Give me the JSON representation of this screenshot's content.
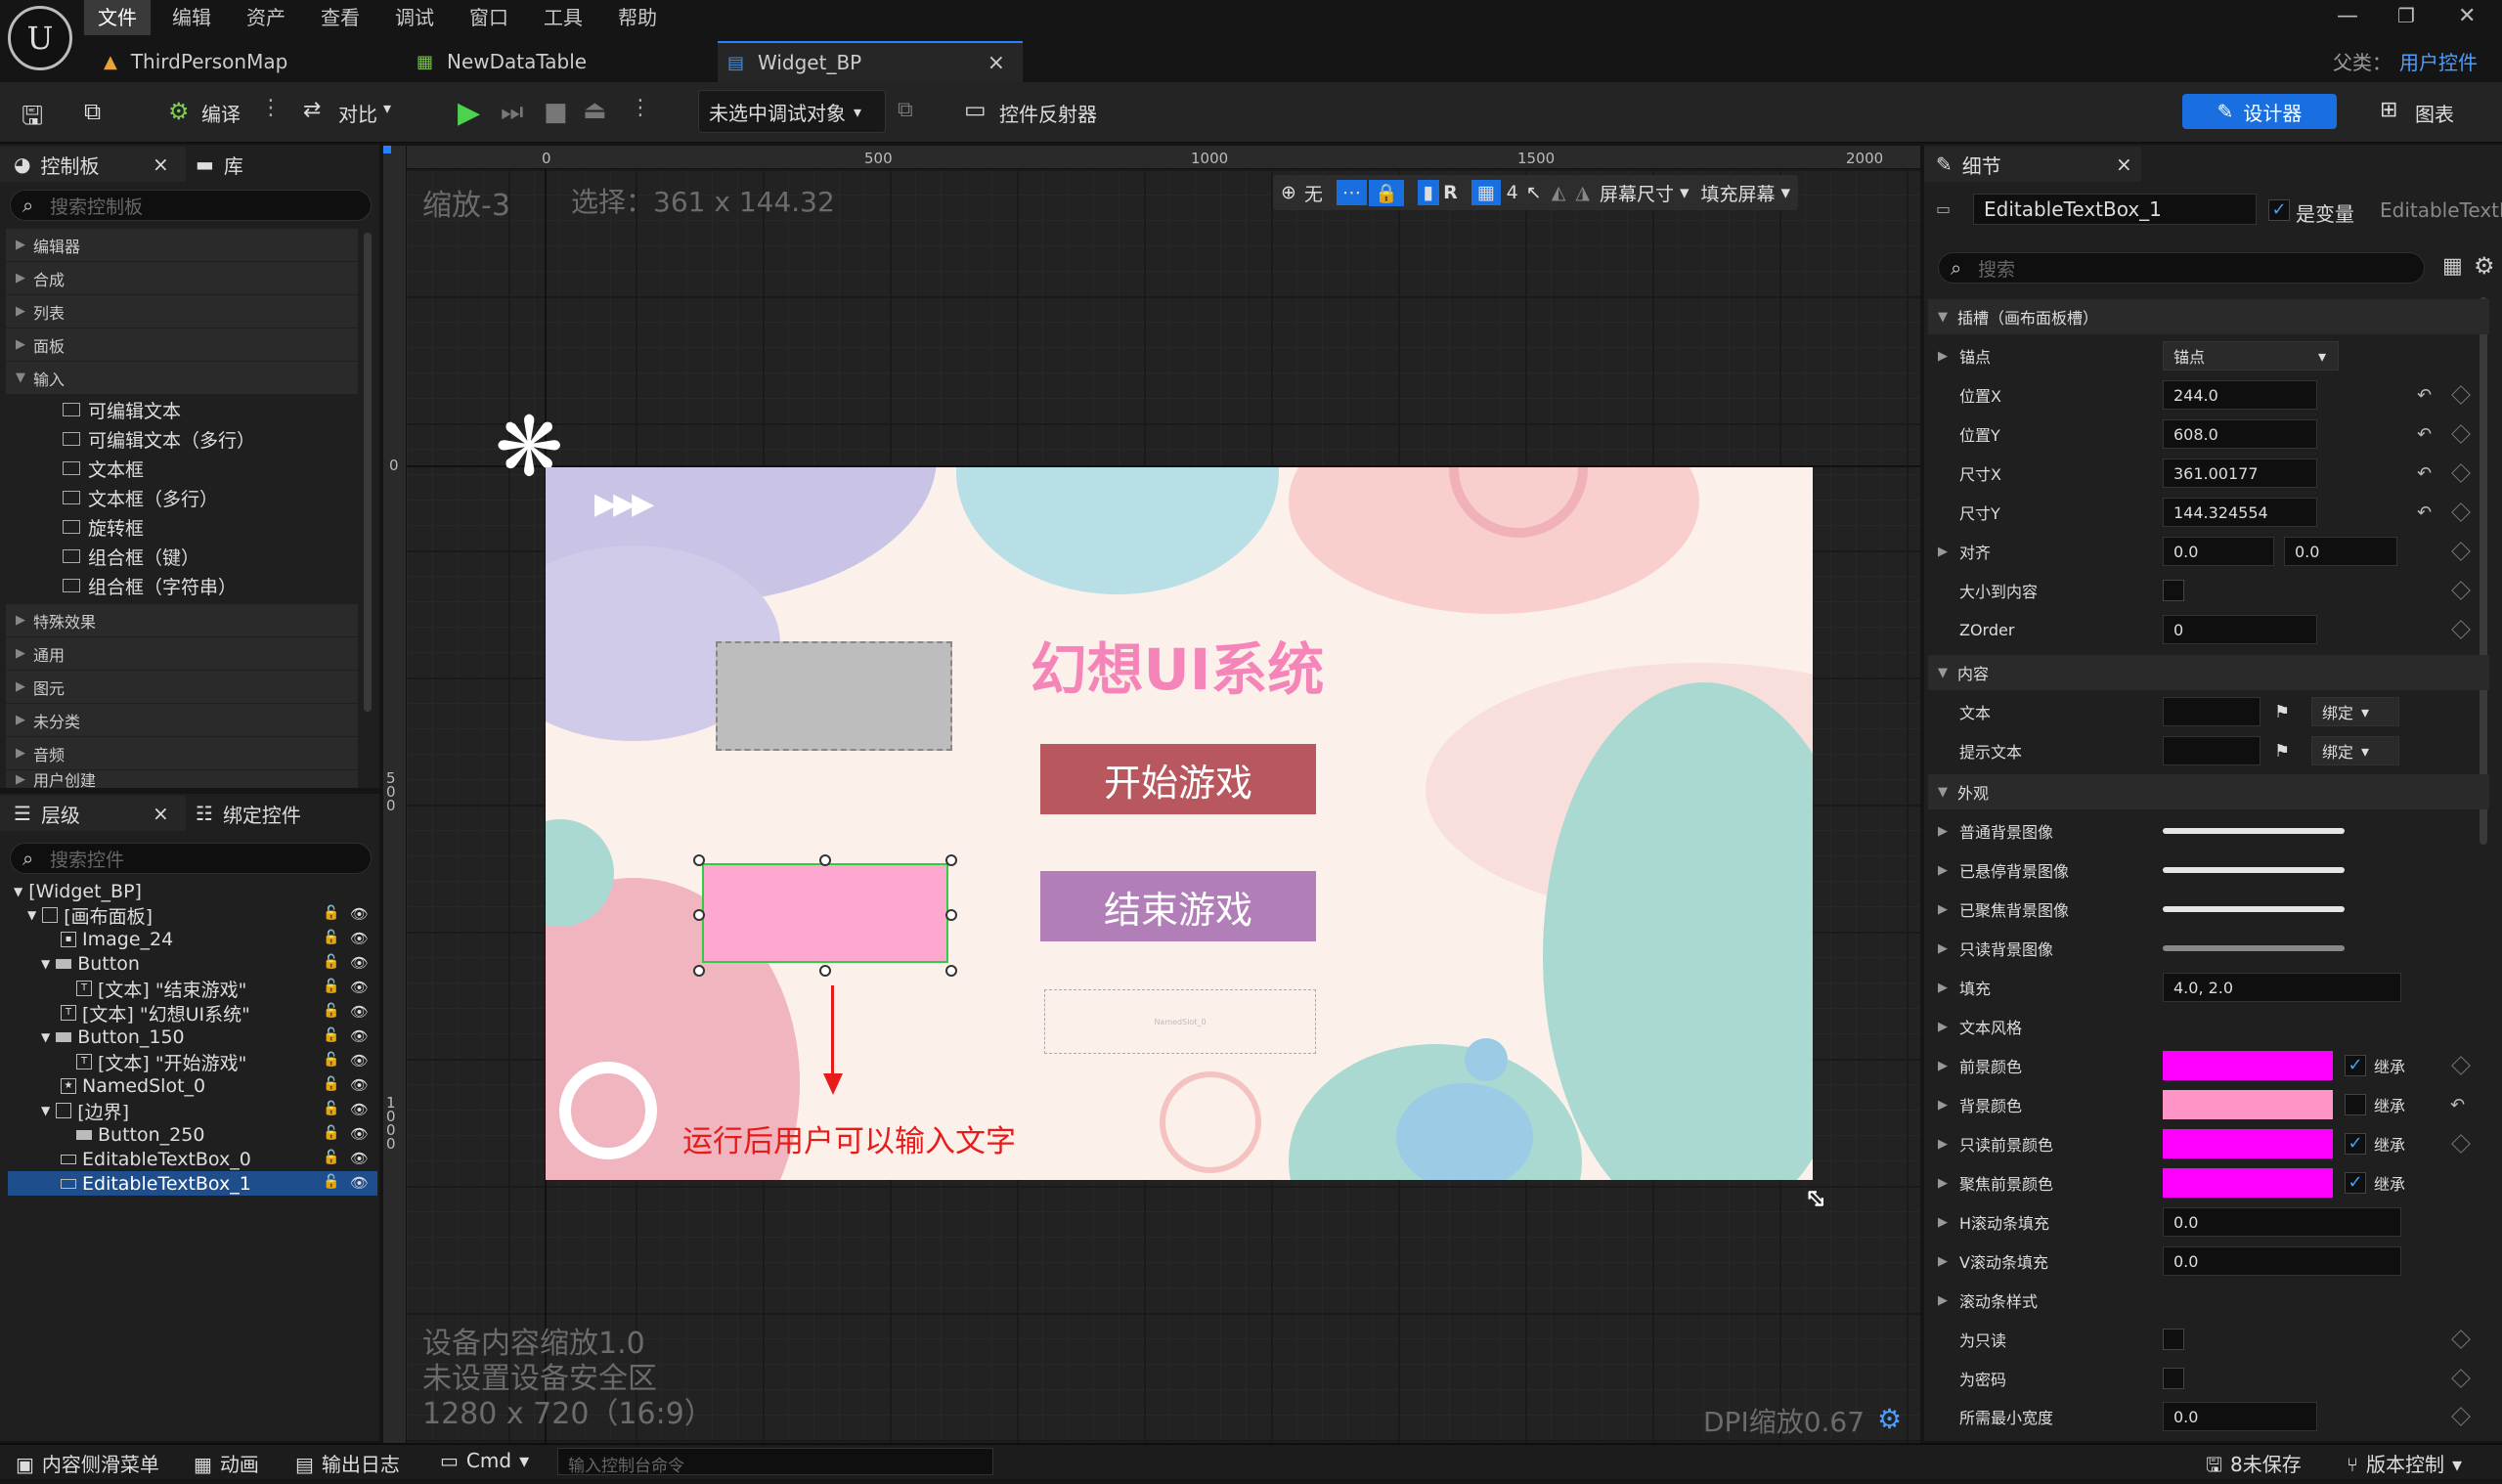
{
  "menu": [
    "文件",
    "编辑",
    "资产",
    "查看",
    "调试",
    "窗口",
    "工具",
    "帮助"
  ],
  "parent_class": {
    "label": "父类：",
    "value": "用户控件"
  },
  "tabs": [
    {
      "label": "ThirdPersonMap"
    },
    {
      "label": "NewDataTable"
    },
    {
      "label": "Widget_BP",
      "close": "×"
    }
  ],
  "toolbar": {
    "compile": "编译",
    "diff": "对比",
    "debug_target": "未选中调试对象",
    "widget_reflector": "控件反射器",
    "designer": "设计器",
    "graph": "图表"
  },
  "palette": {
    "tab": "控制板",
    "library": "库",
    "close": "×",
    "search_placeholder": "搜索控制板",
    "categories": [
      "编辑器",
      "合成",
      "列表",
      "面板",
      "输入"
    ],
    "input_items": [
      "可编辑文本",
      "可编辑文本（多行）",
      "文本框",
      "文本框（多行）",
      "旋转框",
      "组合框（键）",
      "组合框（字符串）"
    ],
    "more_categories": [
      "特殊效果",
      "通用",
      "图元",
      "未分类",
      "音频",
      "用户创建"
    ]
  },
  "hierarchy": {
    "tab": "层级",
    "bind_tab": "绑定控件",
    "close": "×",
    "search_placeholder": "搜索控件",
    "items": [
      {
        "label": "[Widget_BP]"
      },
      {
        "label": "[画布面板]"
      },
      {
        "label": "Image_24"
      },
      {
        "label": "Button"
      },
      {
        "label": "[文本] \"结束游戏\""
      },
      {
        "label": "[文本] \"幻想UI系统\""
      },
      {
        "label": "Button_150"
      },
      {
        "label": "[文本] \"开始游戏\""
      },
      {
        "label": "NamedSlot_0"
      },
      {
        "label": "[边界]"
      },
      {
        "label": "Button_250"
      },
      {
        "label": "EditableTextBox_0"
      },
      {
        "label": "EditableTextBox_1"
      }
    ]
  },
  "viewport": {
    "zoom": "缩放-3",
    "selection": "选择：361 x 144.32",
    "ruler_top": [
      "0",
      "500",
      "1000",
      "1500",
      "2000"
    ],
    "ruler_left": [
      "0",
      "500",
      "1000"
    ],
    "toolbar": {
      "none": "无",
      "r": "R",
      "grid": "4",
      "screen_size": "屏幕尺寸",
      "fill_screen": "填充屏幕"
    },
    "device_scale": "设备内容缩放1.0",
    "safe_zone": "未设置设备安全区",
    "resolution": "1280 x 720（16:9）",
    "dpi": "DPI缩放0.67"
  },
  "game_ui": {
    "title": "幻想UI系统",
    "start": "开始游戏",
    "end": "结束游戏",
    "named_slot": "NamedSlot_0",
    "annotation": "运行后用户可以输入文字"
  },
  "details": {
    "tab": "细节",
    "close": "×",
    "name": "EditableTextBox_1",
    "is_variable": "是变量",
    "class_name": "EditableTextB",
    "search_placeholder": "搜索",
    "slot_section": "插槽（画布面板槽）",
    "anchor": {
      "label": "锚点",
      "value": "锚点"
    },
    "pos_x": {
      "label": "位置X",
      "value": "244.0"
    },
    "pos_y": {
      "label": "位置Y",
      "value": "608.0"
    },
    "size_x": {
      "label": "尺寸X",
      "value": "361.00177"
    },
    "size_y": {
      "label": "尺寸Y",
      "value": "144.324554"
    },
    "alignment": {
      "label": "对齐",
      "x": "0.0",
      "y": "0.0"
    },
    "size_to_content": {
      "label": "大小到内容"
    },
    "zorder": {
      "label": "ZOrder",
      "value": "0"
    },
    "content_section": "内容",
    "text": {
      "label": "文本",
      "bind": "绑定"
    },
    "hint_text": {
      "label": "提示文本",
      "bind": "绑定"
    },
    "appearance_section": "外观",
    "normal_bg": "普通背景图像",
    "hover_bg": "已悬停背景图像",
    "focus_bg": "已聚焦背景图像",
    "readonly_bg": "只读背景图像",
    "padding": {
      "label": "填充",
      "value": "4.0, 2.0"
    },
    "text_style": "文本风格",
    "fg_color": {
      "label": "前景颜色",
      "color": "#ff00ff",
      "inherit": "继承"
    },
    "bg_color": {
      "label": "背景颜色",
      "color": "#ff94c6",
      "inherit": "继承"
    },
    "readonly_fg": {
      "label": "只读前景颜色",
      "color": "#ff00ff",
      "inherit": "继承"
    },
    "focus_fg": {
      "label": "聚焦前景颜色",
      "color": "#ff00ff",
      "inherit": "继承"
    },
    "h_scroll": {
      "label": "H滚动条填充",
      "value": "0.0"
    },
    "v_scroll": {
      "label": "V滚动条填充",
      "value": "0.0"
    },
    "scroll_style": "滚动条样式",
    "readonly": "为只读",
    "password": "为密码",
    "min_width": {
      "label": "所需最小宽度",
      "value": "0.0"
    }
  },
  "bottom": {
    "content_drawer": "内容侧滑菜单",
    "animation": "动画",
    "output_log": "输出日志",
    "cmd": "Cmd",
    "console_placeholder": "输入控制台命令",
    "unsaved": "8未保存",
    "source_control": "版本控制"
  },
  "colors": {
    "accent": "#2a7fff",
    "start_btn": "#b9575f",
    "end_btn": "#b27eb8",
    "selection": "#2ecc40"
  }
}
